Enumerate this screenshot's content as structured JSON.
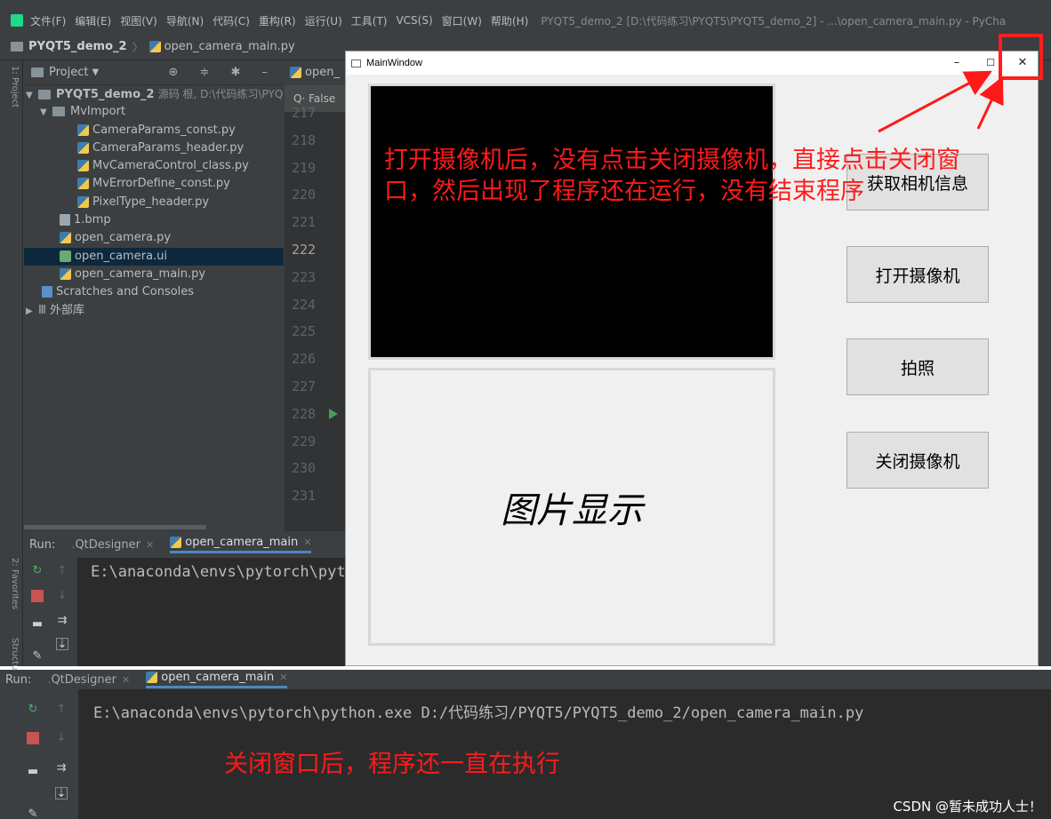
{
  "ide": {
    "menu": [
      "文件(F)",
      "编辑(E)",
      "视图(V)",
      "导航(N)",
      "代码(C)",
      "重构(R)",
      "运行(U)",
      "工具(T)",
      "VCS(S)",
      "窗口(W)",
      "帮助(H)"
    ],
    "window_title": "PYQT5_demo_2 [D:\\代码练习\\PYQT5\\PYQT5_demo_2] - ...\\open_camera_main.py - PyCha",
    "breadcrumb_project": "PYQT5_demo_2",
    "breadcrumb_file": "open_camera_main.py",
    "left_tab": "1: Project",
    "left_tab_favorites": "2: Favorites",
    "left_tab_structure": "Structure",
    "project_panel_title": "Project",
    "tree": {
      "root": "PYQT5_demo_2",
      "root_sub": "源码 根, D:\\代码练习\\PYQ",
      "mvimport": "MvImport",
      "files_mv": [
        "CameraParams_const.py",
        "CameraParams_header.py",
        "MvCameraControl_class.py",
        "MvErrorDefine_const.py",
        "PixelType_header.py"
      ],
      "bmp": "1.bmp",
      "open_camera_py": "open_camera.py",
      "open_camera_ui": "open_camera.ui",
      "open_camera_main": "open_camera_main.py",
      "scratches": "Scratches and Consoles",
      "external": "外部库"
    },
    "editor_tab": "open_",
    "editor_search": "Q· False",
    "line_numbers": [
      "217",
      "218",
      "219",
      "220",
      "221",
      "222",
      "223",
      "224",
      "225",
      "226",
      "227",
      "228",
      "229",
      "230",
      "231"
    ],
    "run": {
      "label": "Run:",
      "tab_qt": "QtDesigner",
      "tab_main": "open_camera_main",
      "console_short": "E:\\anaconda\\envs\\pytorch\\pyt",
      "console_full": "E:\\anaconda\\envs\\pytorch\\python.exe D:/代码练习/PYQT5/PYQT5_demo_2/open_camera_main.py"
    }
  },
  "mainwindow": {
    "title": "MainWindow",
    "minimize": "–",
    "maximize": "☐",
    "close": "✕",
    "image_label": "图片显示",
    "buttons": [
      "获取相机信息",
      "打开摄像机",
      "拍照",
      "关闭摄像机"
    ]
  },
  "annotations": {
    "top_line1": "打开摄像机后，没有点击关闭摄像机，直接点击关闭窗",
    "top_line2": "口，然后出现了程序还在运行，没有结束程序",
    "bottom": "关闭窗口后，程序还一直在执行",
    "color": "#ff1a1a"
  },
  "watermark": "CSDN @暂未成功人士！"
}
